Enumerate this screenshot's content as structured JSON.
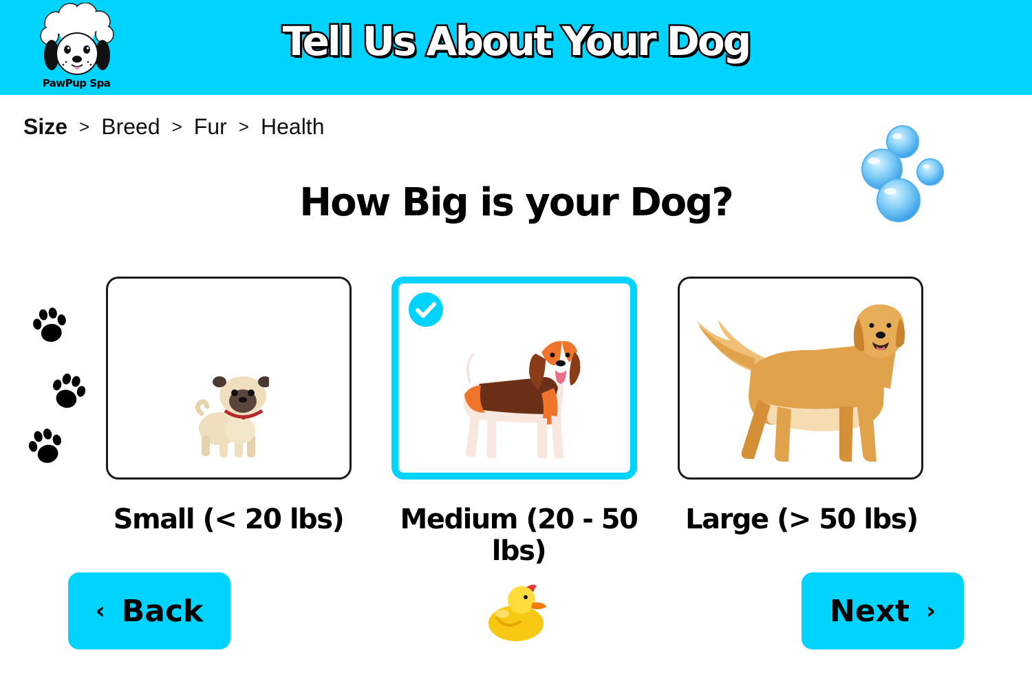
{
  "brand": {
    "name": "PawPup Spa",
    "logo_icon": "poodle-logo-icon"
  },
  "header": {
    "title": "Tell Us About Your Dog"
  },
  "breadcrumb": [
    {
      "label": "Size",
      "active": true
    },
    {
      "label": "Breed",
      "active": false
    },
    {
      "label": "Fur",
      "active": false
    },
    {
      "label": "Health",
      "active": false
    }
  ],
  "breadcrumb_separator": ">",
  "question": "How Big is your Dog?",
  "size_options": [
    {
      "label": "Small (< 20 lbs)",
      "icon": "pug-icon",
      "selected": false
    },
    {
      "label": "Medium (20 - 50 lbs)",
      "icon": "beagle-icon",
      "selected": true
    },
    {
      "label": "Large (> 50 lbs)",
      "icon": "golden-retriever-icon",
      "selected": false
    }
  ],
  "nav": {
    "back_label": "Back",
    "back_icon": "chevron-left-icon",
    "next_label": "Next",
    "next_icon": "chevron-right-icon"
  },
  "decorations": [
    "bubbles-icon",
    "paw-prints-icon",
    "rubber-duck-icon"
  ],
  "colors": {
    "accent": "#00D4FE",
    "text": "#000000",
    "background": "#FFFFFF"
  }
}
